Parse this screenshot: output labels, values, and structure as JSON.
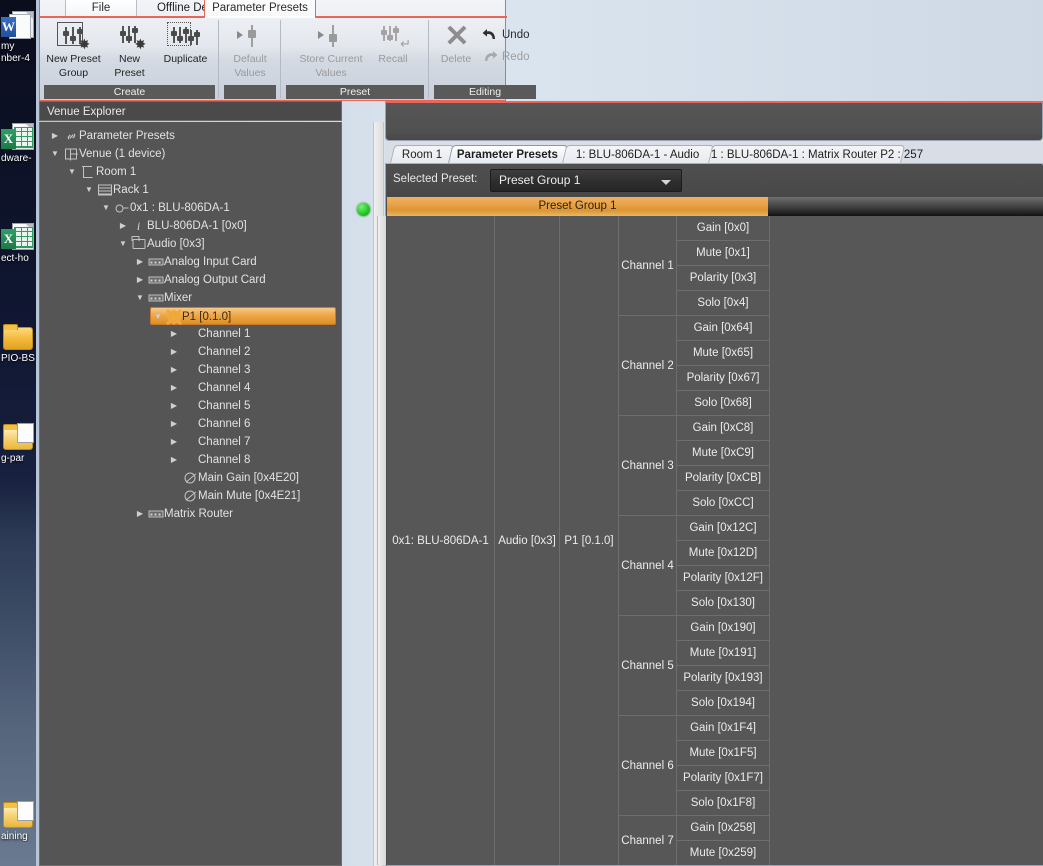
{
  "desktop": {
    "icons": [
      {
        "name": "word-document-icon",
        "type": "word",
        "label": "my",
        "label2": "nber-4"
      },
      {
        "name": "excel-document-icon",
        "type": "excel",
        "label": "dware-"
      },
      {
        "name": "excel-document-icon-2",
        "type": "excel",
        "label": "ect-ho"
      },
      {
        "name": "folder-icon",
        "type": "folder",
        "label": "PIO-BS"
      },
      {
        "name": "folder-open-icon",
        "type": "folder-open",
        "label": "g-par"
      },
      {
        "name": "folder-training-icon",
        "type": "folder-open",
        "label": "aining"
      }
    ]
  },
  "ribbon": {
    "tabs": [
      {
        "label": "File",
        "state": "backstage"
      },
      {
        "label": "Offline Design",
        "state": "inactive"
      },
      {
        "label": "Parameter Presets",
        "state": "active"
      }
    ],
    "groups": [
      {
        "name": "Create",
        "buttons": [
          {
            "label_line1": "New Preset",
            "label_line2": "Group",
            "icon": "new-preset-group-icon",
            "enabled": true
          },
          {
            "label_line1": "New",
            "label_line2": "Preset",
            "icon": "new-preset-icon",
            "enabled": true
          },
          {
            "label_line1": "Duplicate",
            "label_line2": "",
            "icon": "duplicate-icon",
            "enabled": true
          }
        ]
      },
      {
        "name": "",
        "buttons": [
          {
            "label_line1": "Default",
            "label_line2": "Values",
            "icon": "default-values-icon",
            "enabled": false
          }
        ]
      },
      {
        "name": "Preset",
        "buttons": [
          {
            "label_line1": "Store Current",
            "label_line2": "Values",
            "icon": "store-current-values-icon",
            "enabled": false
          },
          {
            "label_line1": "Recall",
            "label_line2": "",
            "icon": "recall-icon",
            "enabled": false
          }
        ]
      },
      {
        "name": "Editing",
        "buttons": [
          {
            "label_line1": "Delete",
            "label_line2": "",
            "icon": "delete-icon",
            "enabled": false
          }
        ],
        "stacked": [
          {
            "label": "Undo",
            "icon": "undo-icon",
            "enabled": true
          },
          {
            "label": "Redo",
            "icon": "redo-icon",
            "enabled": false
          }
        ]
      }
    ]
  },
  "venue_explorer": {
    "title": "Venue Explorer",
    "nodes": [
      {
        "label": "Parameter Presets",
        "depth": 0,
        "twisty": "collapsed",
        "icon": "chain-link-icon",
        "selected": false
      },
      {
        "label": "Venue (1 device)",
        "depth": 0,
        "twisty": "expanded",
        "icon": "venue-icon",
        "selected": false
      },
      {
        "label": "Room 1",
        "depth": 1,
        "twisty": "expanded",
        "icon": "room-icon",
        "selected": false
      },
      {
        "label": "Rack 1",
        "depth": 2,
        "twisty": "expanded",
        "icon": "rack-icon",
        "selected": false
      },
      {
        "label": "0x1 : BLU-806DA-1",
        "depth": 3,
        "twisty": "expanded",
        "icon": "device-icon",
        "selected": false,
        "status": "online"
      },
      {
        "label": "BLU-806DA-1 [0x0]",
        "depth": 4,
        "twisty": "collapsed",
        "icon": "info-icon",
        "selected": false
      },
      {
        "label": "Audio [0x3]",
        "depth": 4,
        "twisty": "expanded",
        "icon": "folder-icon",
        "selected": false
      },
      {
        "label": "Analog Input Card",
        "depth": 5,
        "twisty": "collapsed",
        "icon": "card-icon",
        "selected": false
      },
      {
        "label": "Analog Output Card",
        "depth": 5,
        "twisty": "collapsed",
        "icon": "card-icon",
        "selected": false
      },
      {
        "label": "Mixer",
        "depth": 5,
        "twisty": "expanded",
        "icon": "card-icon",
        "selected": false
      },
      {
        "label": "P1 [0.1.0]",
        "depth": 6,
        "twisty": "expanded",
        "icon": "gear-icon",
        "selected": true
      },
      {
        "label": "Channel 1",
        "depth": 7,
        "twisty": "collapsed",
        "icon": "none",
        "selected": false
      },
      {
        "label": "Channel 2",
        "depth": 7,
        "twisty": "collapsed",
        "icon": "none",
        "selected": false
      },
      {
        "label": "Channel 3",
        "depth": 7,
        "twisty": "collapsed",
        "icon": "none",
        "selected": false
      },
      {
        "label": "Channel 4",
        "depth": 7,
        "twisty": "collapsed",
        "icon": "none",
        "selected": false
      },
      {
        "label": "Channel 5",
        "depth": 7,
        "twisty": "collapsed",
        "icon": "none",
        "selected": false
      },
      {
        "label": "Channel 6",
        "depth": 7,
        "twisty": "collapsed",
        "icon": "none",
        "selected": false
      },
      {
        "label": "Channel 7",
        "depth": 7,
        "twisty": "collapsed",
        "icon": "none",
        "selected": false
      },
      {
        "label": "Channel 8",
        "depth": 7,
        "twisty": "collapsed",
        "icon": "none",
        "selected": false
      },
      {
        "label": "Main Gain [0x4E20]",
        "depth": 7,
        "twisty": "none",
        "icon": "param-icon",
        "selected": false
      },
      {
        "label": "Main Mute [0x4E21]",
        "depth": 7,
        "twisty": "none",
        "icon": "param-icon",
        "selected": false
      },
      {
        "label": "Matrix Router",
        "depth": 5,
        "twisty": "collapsed",
        "icon": "card-icon",
        "selected": false
      }
    ]
  },
  "document_tabs": [
    {
      "label": "Room 1",
      "selected": false
    },
    {
      "label": "Parameter Presets",
      "selected": true
    },
    {
      "label": "1: BLU-806DA-1 - Audio",
      "selected": false
    },
    {
      "label": "1 : BLU-806DA-1 : Matrix Router P2 : 257",
      "selected": false
    }
  ],
  "preset_bar": {
    "label": "Selected Preset:",
    "selected_value": "Preset Group 1",
    "options": [
      "Preset Group 1"
    ],
    "group_band_label": "Preset Group 1"
  },
  "grid": {
    "device": "0x1: BLU-806DA-1",
    "object": "Audio [0x3]",
    "block": "P1 [0.1.0]",
    "channels": [
      {
        "name": "Channel 1",
        "params": [
          "Gain [0x0]",
          "Mute [0x1]",
          "Polarity [0x3]",
          "Solo [0x4]"
        ]
      },
      {
        "name": "Channel 2",
        "params": [
          "Gain [0x64]",
          "Mute [0x65]",
          "Polarity [0x67]",
          "Solo [0x68]"
        ]
      },
      {
        "name": "Channel 3",
        "params": [
          "Gain [0xC8]",
          "Mute [0xC9]",
          "Polarity [0xCB]",
          "Solo [0xCC]"
        ]
      },
      {
        "name": "Channel 4",
        "params": [
          "Gain [0x12C]",
          "Mute [0x12D]",
          "Polarity [0x12F]",
          "Solo [0x130]"
        ]
      },
      {
        "name": "Channel 5",
        "params": [
          "Gain [0x190]",
          "Mute [0x191]",
          "Polarity [0x193]",
          "Solo [0x194]"
        ]
      },
      {
        "name": "Channel 6",
        "params": [
          "Gain [0x1F4]",
          "Mute [0x1F5]",
          "Polarity [0x1F7]",
          "Solo [0x1F8]"
        ]
      },
      {
        "name": "Channel 7",
        "params": [
          "Gain [0x258]",
          "Mute [0x259]"
        ]
      }
    ]
  },
  "colors": {
    "accent_orange": "#e8a249",
    "selection_orange": "#eda748",
    "panel_gray": "#555555",
    "grid_gray": "#575757",
    "status_green": "#24cc24",
    "ribbon_red": "#e8665a"
  }
}
